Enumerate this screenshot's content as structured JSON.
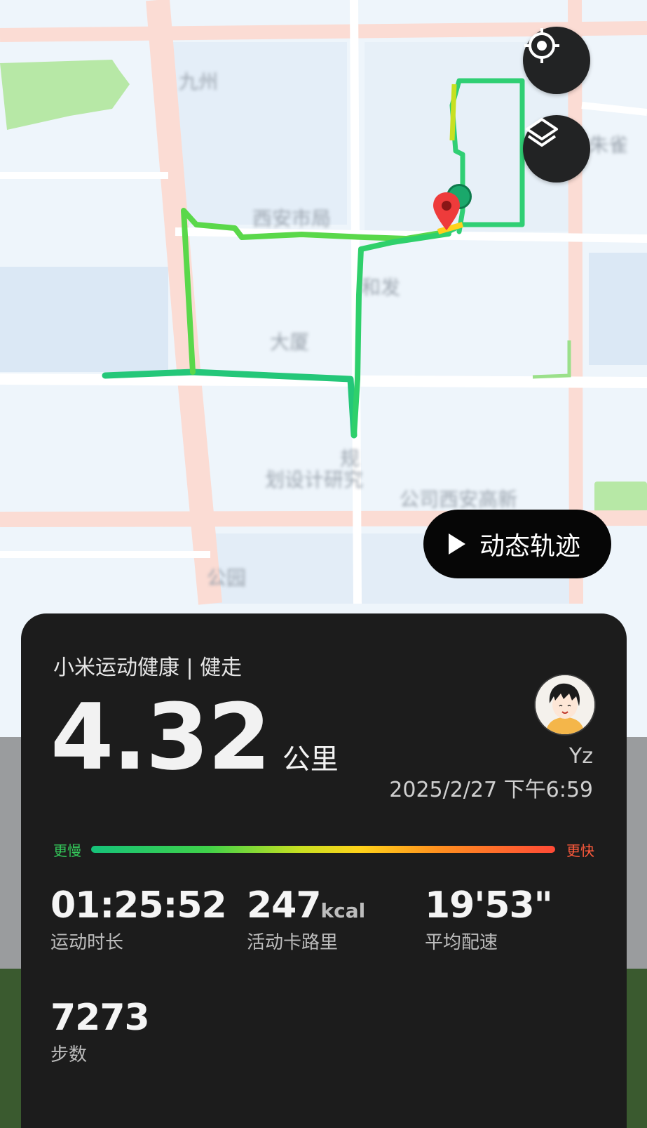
{
  "map": {
    "replay_button_label": "动态轨迹",
    "blurred_labels": [
      "规",
      "划设计研究",
      "公司西安高新",
      "和发"
    ]
  },
  "colors": {
    "card_background": "#1c1c1c",
    "route_green": "#2fd06b",
    "slow_color": "#34c85a",
    "fast_color": "#ff5a3c",
    "map_road": "#ffffff",
    "map_arterial": "#fbdcd4"
  },
  "icons": {
    "locate": "locate-icon",
    "layers": "layers-icon",
    "play": "play-icon",
    "start_pin": "start-pin-icon"
  },
  "card": {
    "title": "小米运动健康 | 健走",
    "distance_value": "4.32",
    "distance_unit": "公里",
    "user_name": "Yz",
    "datetime": "2025/2/27 下午6:59",
    "pace_slow_label": "更慢",
    "pace_fast_label": "更快",
    "stats": [
      {
        "value": "01:25:52",
        "unit": "",
        "label": "运动时长"
      },
      {
        "value": "247",
        "unit": "kcal",
        "label": "活动卡路里"
      },
      {
        "value": "19'53\"",
        "unit": "",
        "label": "平均配速"
      },
      {
        "value": "7273",
        "unit": "",
        "label": "步数"
      }
    ]
  }
}
